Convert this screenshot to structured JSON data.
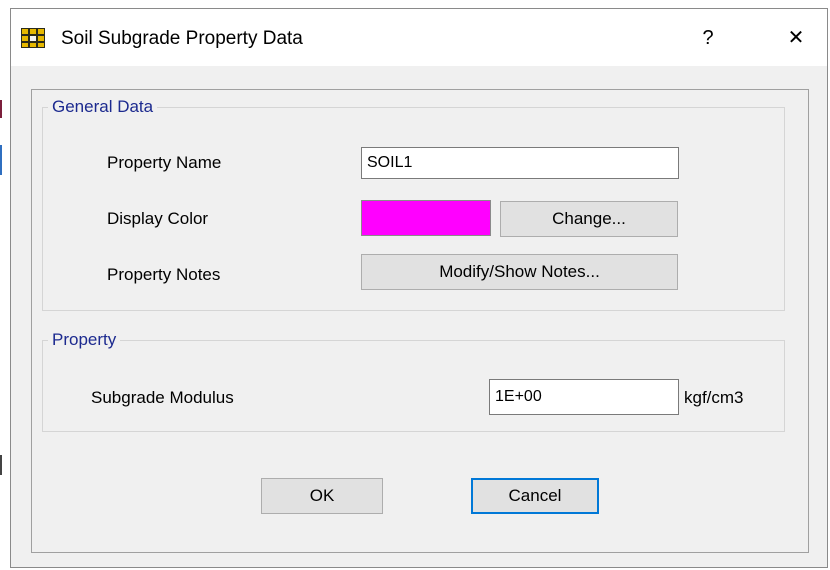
{
  "dialog": {
    "title": "Soil Subgrade Property Data",
    "help_label": "?",
    "close_label": "✕"
  },
  "general": {
    "group_label": "General Data",
    "property_name_label": "Property Name",
    "property_name_value": "SOIL1",
    "display_color_label": "Display Color",
    "display_color": "#ff00ff",
    "change_label": "Change...",
    "property_notes_label": "Property Notes",
    "modify_notes_label": "Modify/Show Notes..."
  },
  "property": {
    "group_label": "Property",
    "subgrade_modulus_label": "Subgrade Modulus",
    "subgrade_modulus_value": "1E+00",
    "unit": "kgf/cm3"
  },
  "buttons": {
    "ok_label": "OK",
    "cancel_label": "Cancel"
  },
  "colors": {
    "group_label_color": "#1c2a8f",
    "focus_border": "#0078d7"
  }
}
